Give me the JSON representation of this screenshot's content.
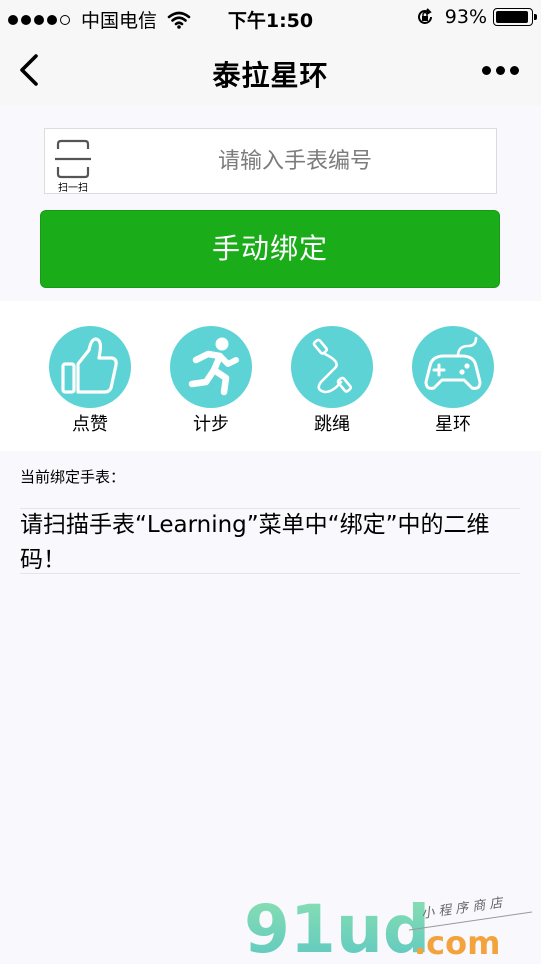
{
  "status_bar": {
    "carrier": "中国电信",
    "time": "下午1:50",
    "battery_percent": "93%",
    "battery_level": 0.93,
    "signal_bars_filled": 4,
    "signal_bars_total": 5
  },
  "nav": {
    "title": "泰拉星环"
  },
  "binding": {
    "scan_label": "扫一扫",
    "input_placeholder": "请输入手表编号",
    "input_value": "",
    "manual_bind_label": "手动绑定"
  },
  "features": [
    {
      "label": "点赞",
      "icon": "thumbs-up-icon"
    },
    {
      "label": "计步",
      "icon": "running-man-icon"
    },
    {
      "label": "跳绳",
      "icon": "jump-rope-icon"
    },
    {
      "label": "星环",
      "icon": "gamepad-icon"
    }
  ],
  "current_watch": {
    "label": "当前绑定手表：",
    "message": "请扫描手表“Learning”菜单中“绑定”中的二维码！"
  },
  "watermark": {
    "logo": "91ud.com",
    "tagline": "小程序商店"
  },
  "colors": {
    "accent_green": "#1aad19",
    "icon_teal": "#5dd3d5",
    "background": "#f9f8fd"
  }
}
